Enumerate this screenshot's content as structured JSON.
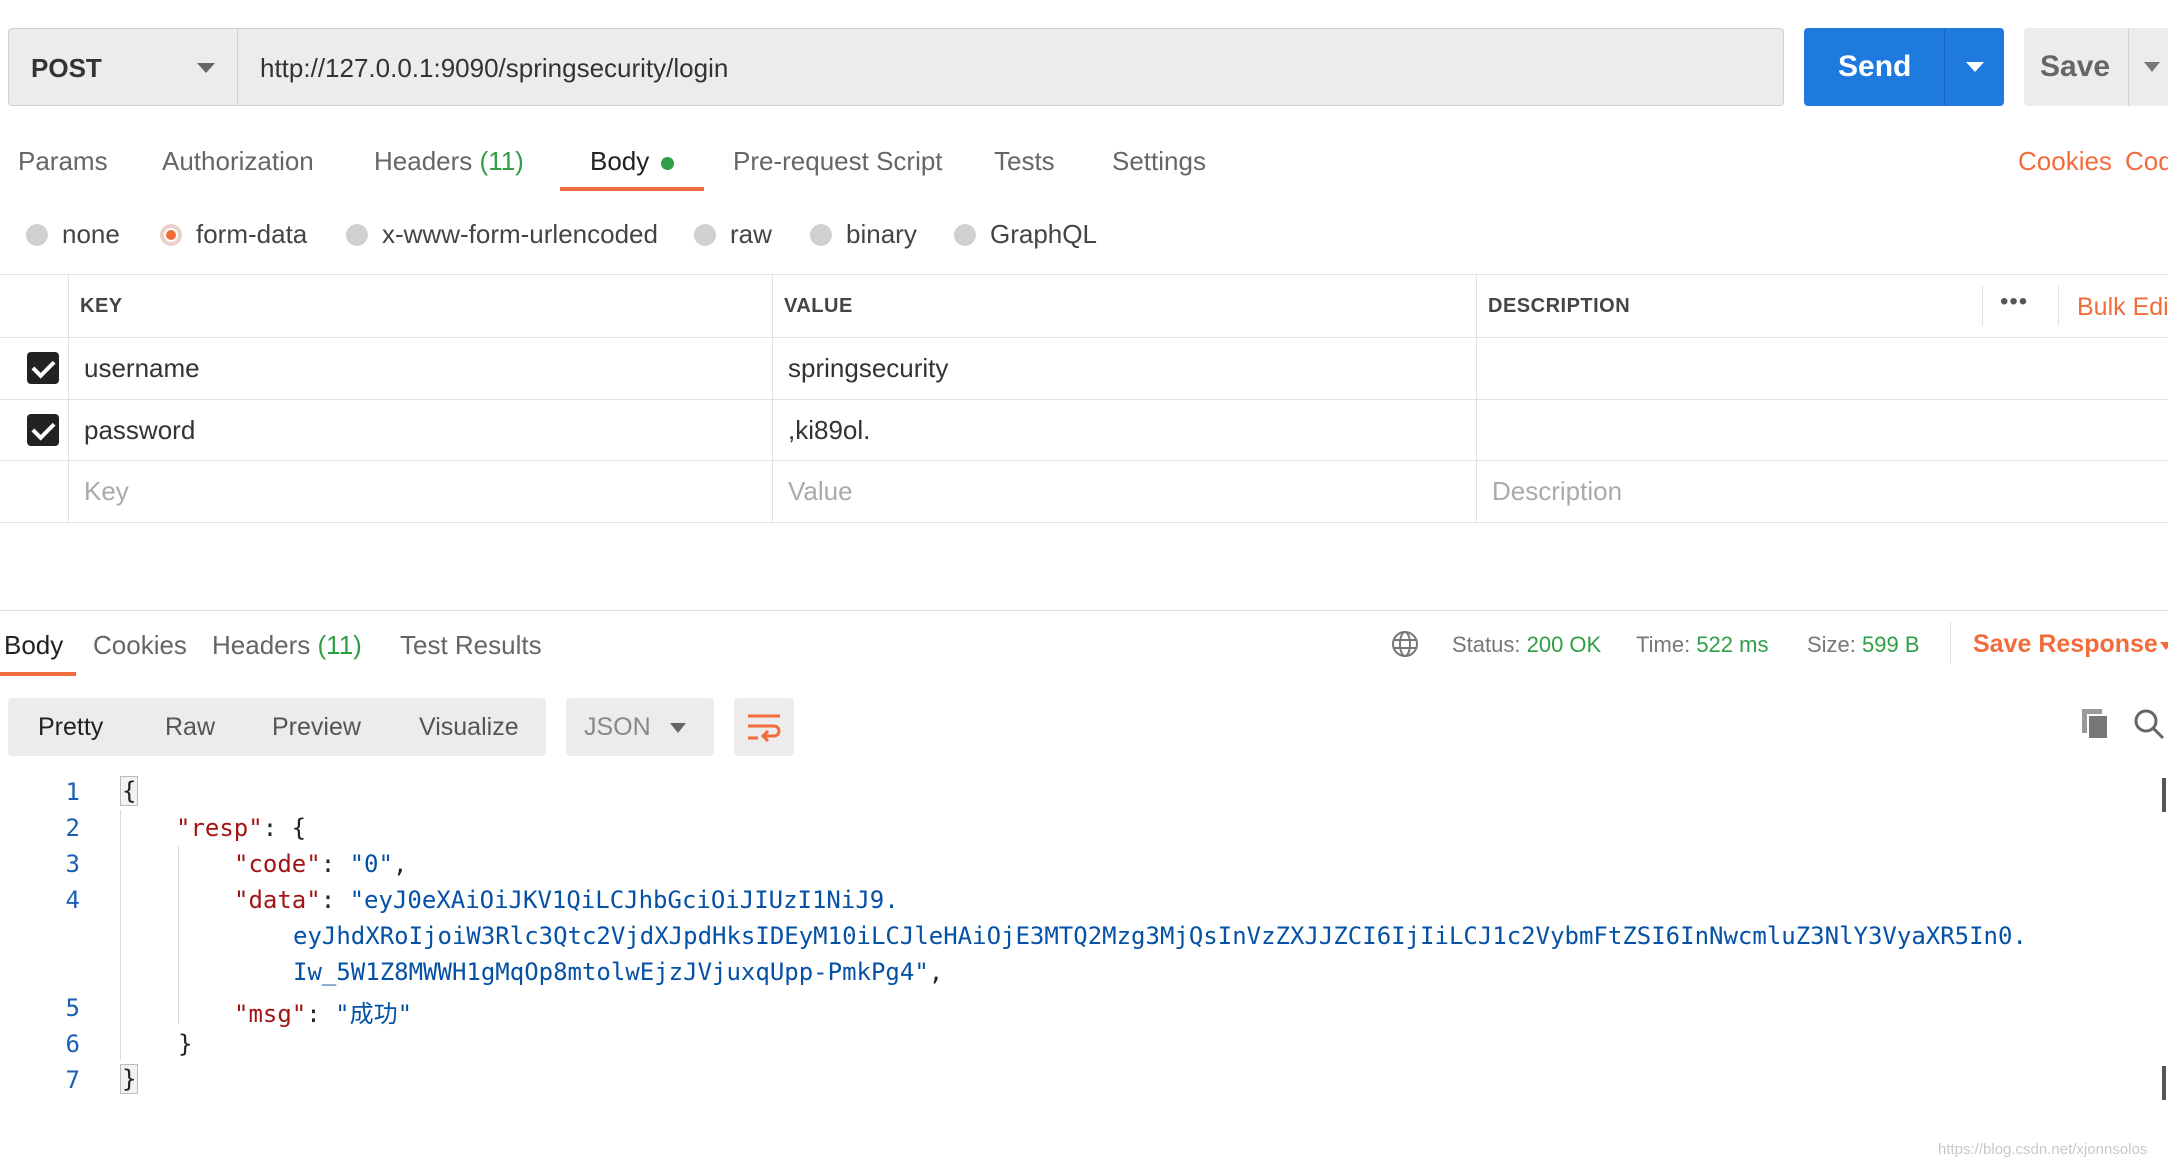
{
  "request": {
    "method": "POST",
    "url": "http://127.0.0.1:9090/springsecurity/login",
    "send_label": "Send",
    "save_label": "Save"
  },
  "request_tabs": [
    {
      "label": "Params"
    },
    {
      "label": "Authorization"
    },
    {
      "label": "Headers",
      "count": "(11)"
    },
    {
      "label": "Body"
    },
    {
      "label": "Pre-request Script"
    },
    {
      "label": "Tests"
    },
    {
      "label": "Settings"
    }
  ],
  "right_links": {
    "cookies": "Cookies",
    "code": "Code"
  },
  "body_types": [
    {
      "label": "none"
    },
    {
      "label": "form-data",
      "selected": true
    },
    {
      "label": "x-www-form-urlencoded"
    },
    {
      "label": "raw"
    },
    {
      "label": "binary"
    },
    {
      "label": "GraphQL"
    }
  ],
  "params_table": {
    "headers": {
      "key": "KEY",
      "value": "VALUE",
      "description": "DESCRIPTION"
    },
    "more": "•••",
    "bulk_edit": "Bulk Edit",
    "rows": [
      {
        "checked": true,
        "key": "username",
        "value": "springsecurity",
        "description": ""
      },
      {
        "checked": true,
        "key": "password",
        "value": ",ki89ol.",
        "description": ""
      }
    ],
    "placeholders": {
      "key": "Key",
      "value": "Value",
      "description": "Description"
    }
  },
  "response": {
    "tabs": [
      {
        "label": "Body"
      },
      {
        "label": "Cookies"
      },
      {
        "label": "Headers",
        "count": "(11)"
      },
      {
        "label": "Test Results"
      }
    ],
    "status_label": "Status:",
    "status": "200 OK",
    "time_label": "Time:",
    "time": "522 ms",
    "size_label": "Size:",
    "size": "599 B",
    "save_response": "Save Response",
    "views": [
      "Pretty",
      "Raw",
      "Preview",
      "Visualize"
    ],
    "format": "JSON",
    "lines": [
      "1",
      "2",
      "3",
      "4",
      "5",
      "6",
      "7"
    ],
    "body": {
      "open": "{",
      "resp_key": "\"resp\"",
      "code_key": "\"code\"",
      "code_val": "\"0\"",
      "data_key": "\"data\"",
      "data_val_1": "\"eyJ0eXAiOiJKV1QiLCJhbGciOiJIUzI1NiJ9.",
      "data_val_2": "eyJhdXRoIjoiW3Rlc3Qtc2VjdXJpdHksIDEyM10iLCJleHAiOjE3MTQ2Mzg3MjQsInVzZXJJZCI6IjIiLCJ1c2VybmFtZSI6InNwcmluZ3NlY3VyaXR5In0.",
      "data_val_3": "Iw_5W1Z8MWWH1gMqOp8mtolwEjzJVjuxqUpp-PmkPg4\"",
      "msg_key": "\"msg\"",
      "msg_val": "\"成功\"",
      "inner_close": "}",
      "close": "}"
    }
  },
  "watermark": "https://blog.csdn.net/xjonnsolos",
  "colors": {
    "accent": "#f26b3a",
    "send": "#1f7ae0",
    "success": "#2f9e44"
  }
}
